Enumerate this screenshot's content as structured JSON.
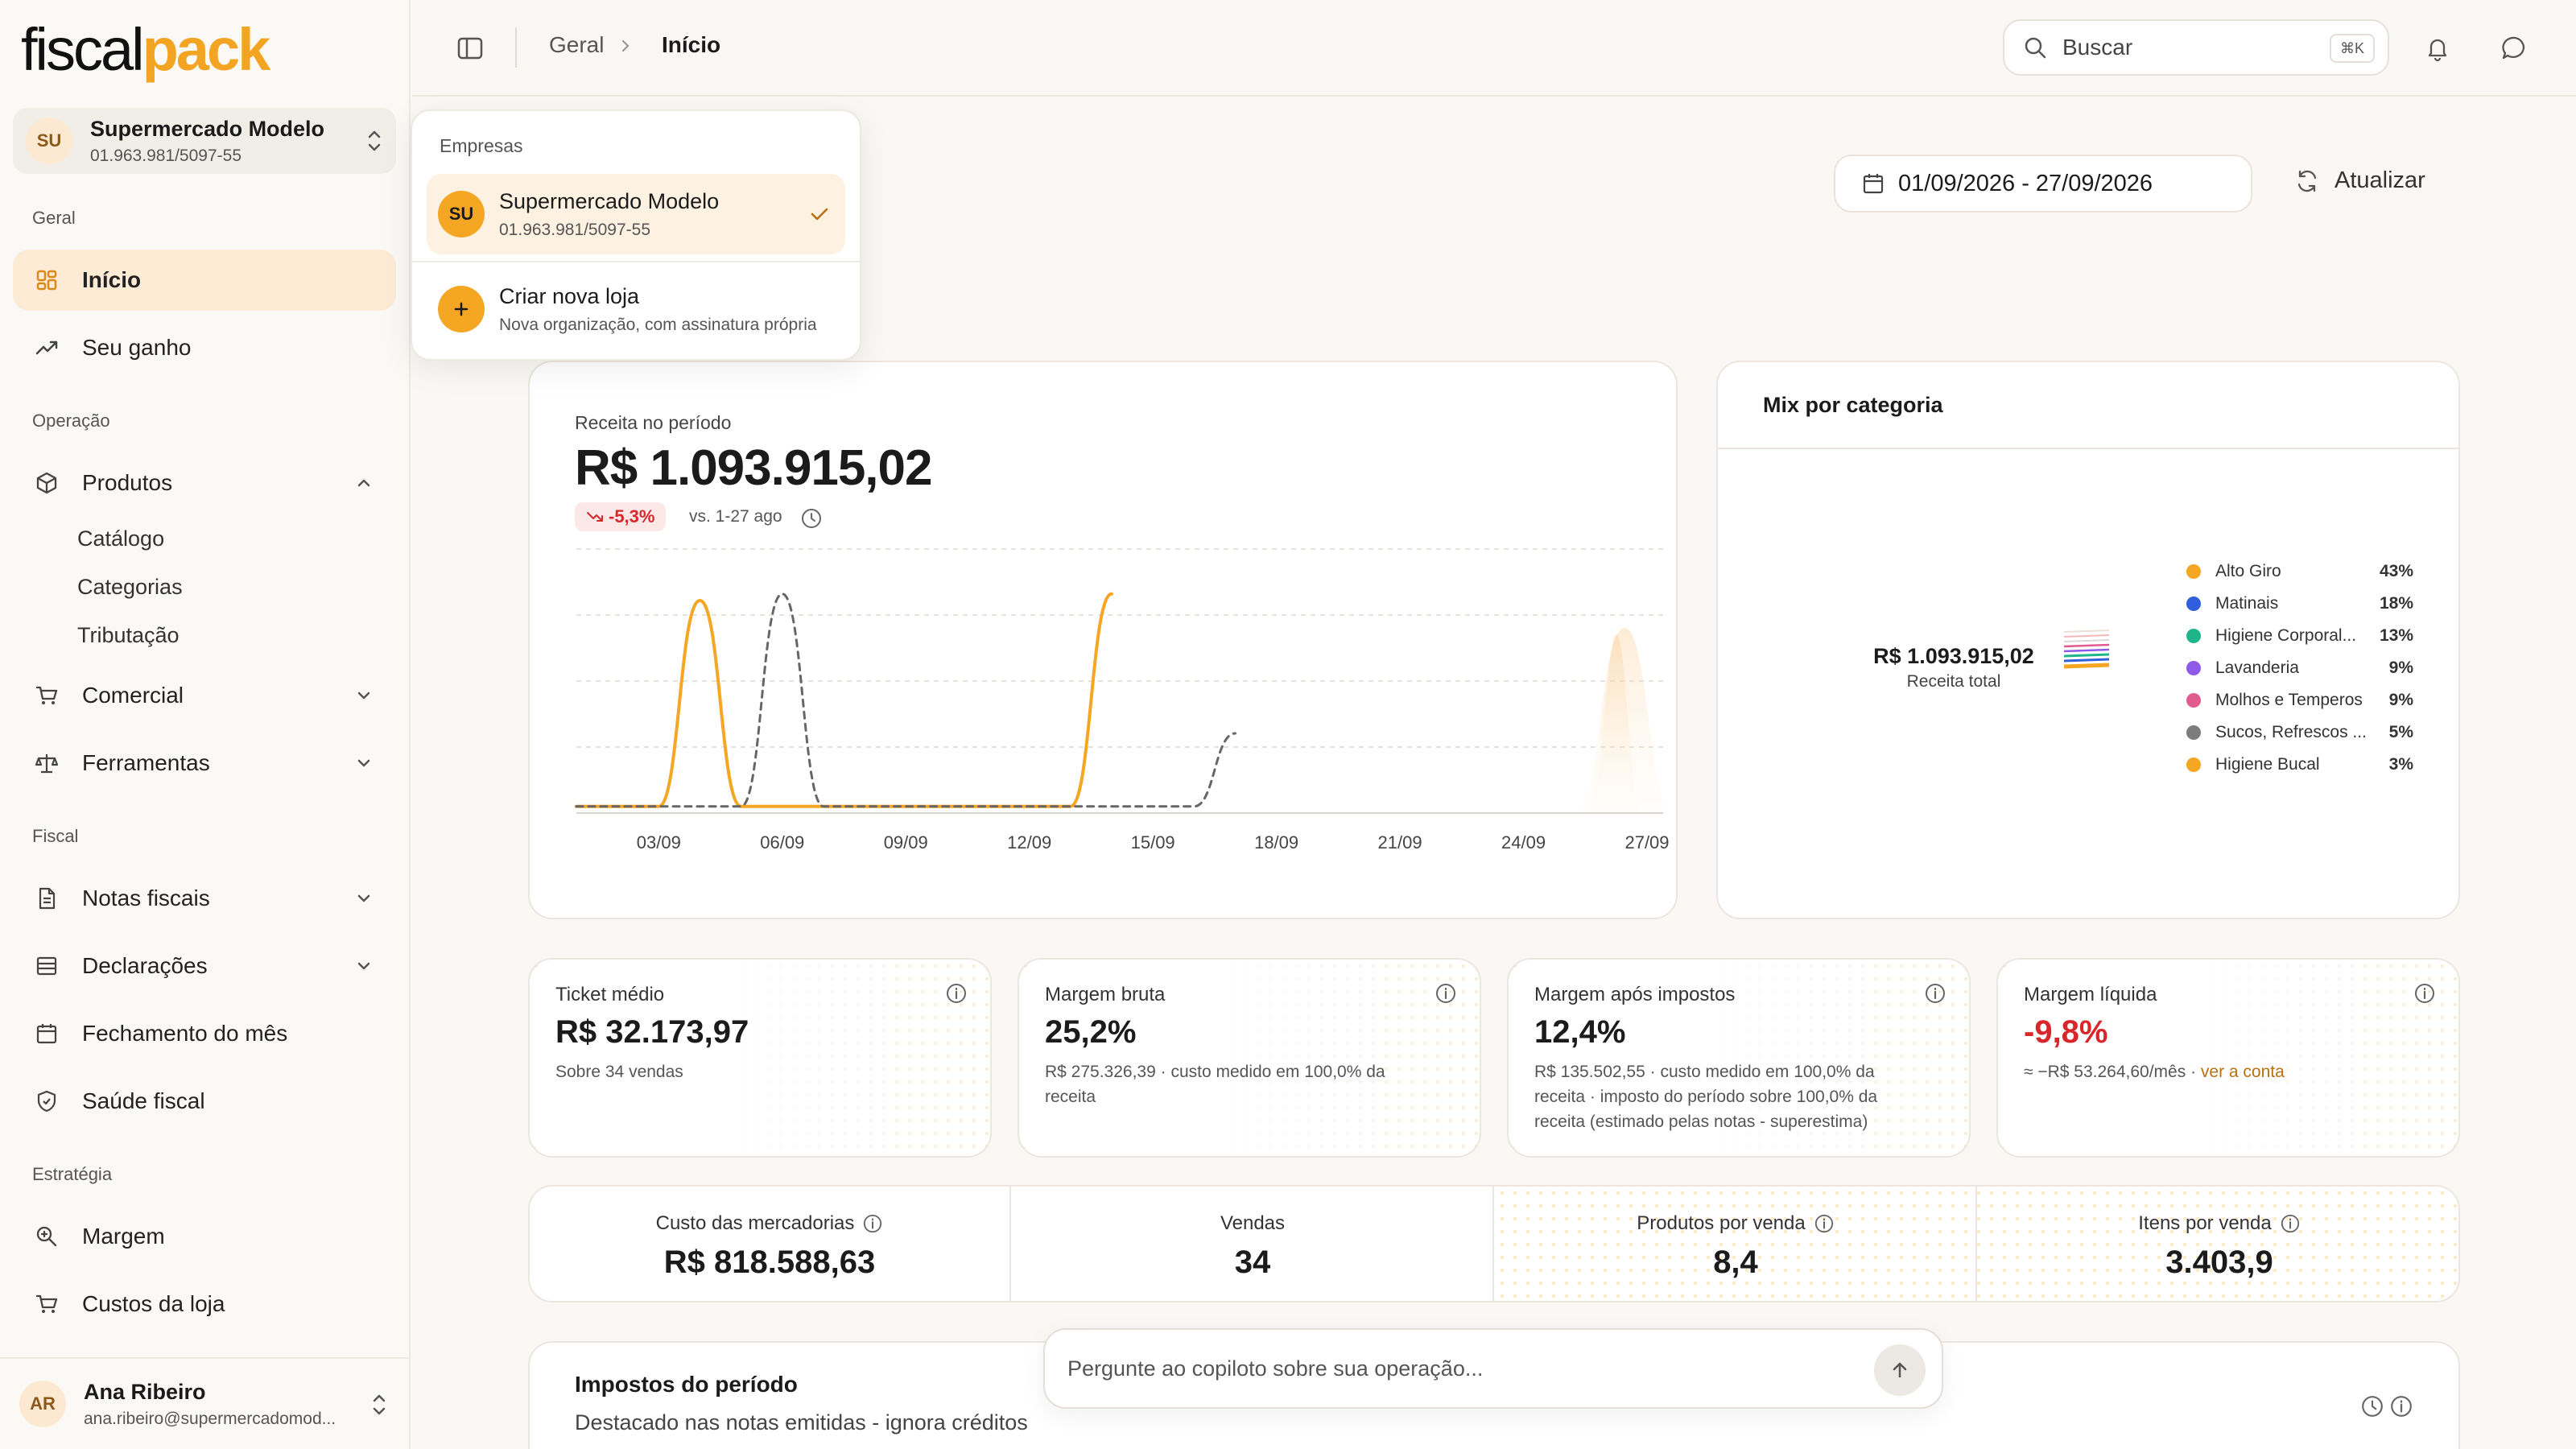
{
  "app": {
    "logo_a": "fiscal",
    "logo_b": "pack"
  },
  "org": {
    "initials": "SU",
    "name": "Supermercado Modelo",
    "cnpj": "01.963.981/5097-55"
  },
  "sidebar": {
    "sections": {
      "geral": "Geral",
      "operacao": "Operação",
      "fiscal": "Fiscal",
      "estrategia": "Estratégia"
    },
    "items": {
      "inicio": "Início",
      "ganho": "Seu ganho",
      "produtos": "Produtos",
      "catalogo": "Catálogo",
      "categorias": "Categorias",
      "tributacao": "Tributação",
      "comercial": "Comercial",
      "ferramentas": "Ferramentas",
      "notas": "Notas fiscais",
      "declaracoes": "Declarações",
      "fechamento": "Fechamento do mês",
      "saude": "Saúde fiscal",
      "margem": "Margem",
      "custos": "Custos da loja"
    }
  },
  "user": {
    "initials": "AR",
    "name": "Ana Ribeiro",
    "email": "ana.ribeiro@supermercadomod..."
  },
  "topbar": {
    "crumb_root": "Geral",
    "crumb_current": "Início",
    "search_placeholder": "Buscar",
    "search_kbd": "⌘K"
  },
  "filters": {
    "daterange": "01/09/2026 - 27/09/2026",
    "refresh": "Atualizar"
  },
  "dropdown": {
    "header": "Empresas",
    "org_initials": "SU",
    "org_name": "Supermercado Modelo",
    "org_cnpj": "01.963.981/5097-55",
    "create_label": "Criar nova loja",
    "create_sub": "Nova organização, com assinatura própria"
  },
  "revenue": {
    "label": "Receita no período",
    "value": "R$ 1.093.915,02",
    "delta": "-5,3%",
    "compare": "vs. 1-27 ago"
  },
  "chart_data": {
    "type": "line",
    "x": [
      "01/09",
      "02/09",
      "03/09",
      "04/09",
      "05/09",
      "06/09",
      "07/09",
      "08/09",
      "09/09",
      "10/09",
      "11/09",
      "12/09",
      "13/09",
      "14/09",
      "15/09",
      "16/09",
      "17/09",
      "18/09",
      "19/09",
      "20/09",
      "21/09",
      "22/09",
      "23/09",
      "24/09",
      "25/09",
      "26/09",
      "27/09"
    ],
    "xticks": [
      "03/09",
      "06/09",
      "09/09",
      "12/09",
      "15/09",
      "18/09",
      "21/09",
      "24/09",
      "27/09"
    ],
    "series": [
      {
        "name": "Receita",
        "style": "solid",
        "color": "#f5a623",
        "values": [
          4,
          4,
          4,
          128,
          4,
          4,
          4,
          4,
          4,
          4,
          4,
          4,
          4,
          132,
          null,
          null,
          null,
          null,
          null,
          null,
          null,
          null,
          null,
          null,
          null,
          null,
          null
        ]
      },
      {
        "name": "Período anterior",
        "style": "dashed",
        "color": "#666666",
        "values": [
          4,
          4,
          4,
          4,
          4,
          132,
          4,
          4,
          4,
          4,
          4,
          4,
          4,
          4,
          4,
          4,
          48,
          null,
          null,
          null,
          null,
          null,
          null,
          null,
          null,
          null,
          null
        ]
      }
    ],
    "ylim": [
      0,
      160
    ],
    "grid": true
  },
  "mix": {
    "title": "Mix por categoria",
    "total_value": "R$ 1.093.915,02",
    "total_label": "Receita total",
    "categories": [
      {
        "name": "Alto Giro",
        "pct": "43%",
        "color": "#f5a623"
      },
      {
        "name": "Matinais",
        "pct": "18%",
        "color": "#2f5fdc"
      },
      {
        "name": "Higiene Corporal...",
        "pct": "13%",
        "color": "#1fb58a"
      },
      {
        "name": "Lavanderia",
        "pct": "9%",
        "color": "#8f5ae8"
      },
      {
        "name": "Molhos e Temperos",
        "pct": "9%",
        "color": "#e25b8f"
      },
      {
        "name": "Sucos, Refrescos ...",
        "pct": "5%",
        "color": "#7c7c7c"
      },
      {
        "name": "Higiene Bucal",
        "pct": "3%",
        "color": "#f5a623"
      }
    ]
  },
  "kpis": [
    {
      "title": "Ticket médio",
      "value": "R$ 32.173,97",
      "sub": "Sobre 34 vendas"
    },
    {
      "title": "Margem bruta",
      "value": "25,2%",
      "sub": "R$ 275.326,39 · custo medido em 100,0% da receita"
    },
    {
      "title": "Margem após impostos",
      "value": "12,4%",
      "sub": "R$ 135.502,55 · custo medido em 100,0% da receita · imposto do período sobre 100,0% da receita (estimado pelas notas - superestima)"
    },
    {
      "title": "Margem líquida",
      "value": "-9,8%",
      "sub": "≈ −R$ 53.264,60/mês · ",
      "link": "ver a conta"
    }
  ],
  "metrics": [
    {
      "label": "Custo das mercadorias",
      "value": "R$ 818.588,63"
    },
    {
      "label": "Vendas",
      "value": "34"
    },
    {
      "label": "Produtos por venda",
      "value": "8,4"
    },
    {
      "label": "Itens por venda",
      "value": "3.403,9"
    }
  ],
  "taxes": {
    "title": "Impostos do período",
    "sub": "Destacado nas notas emitidas - ignora créditos"
  },
  "copilot": {
    "placeholder": "Pergunte ao copiloto sobre sua operação..."
  },
  "colors": {
    "accent": "#f5a623",
    "active_bg": "#fdebd5",
    "negative": "#d8262b"
  }
}
